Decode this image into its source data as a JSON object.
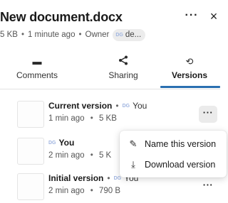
{
  "header": {
    "title": "New document.docx",
    "more_label": "···",
    "close_label": "×",
    "meta": {
      "size": "5 KB",
      "modified": "1 minute ago",
      "owner_label": "Owner",
      "owner_avatar": "DG",
      "owner_name": "de..."
    }
  },
  "tabs": [
    {
      "label": "Comments",
      "icon": "comment-icon",
      "glyph": "▬"
    },
    {
      "label": "Sharing",
      "icon": "share-icon",
      "glyph": "<"
    },
    {
      "label": "Versions",
      "icon": "history-icon",
      "glyph": "⟲",
      "active": true
    }
  ],
  "versions": [
    {
      "title": "Current version",
      "avatar": "DG",
      "user": "You",
      "time": "1 min ago",
      "size": "5 KB",
      "more": "···"
    },
    {
      "title": "",
      "avatar": "DG",
      "user": "You",
      "time": "2 min ago",
      "size": "5 K",
      "more": "···"
    },
    {
      "title": "Initial version",
      "avatar": "DG",
      "user": "You",
      "time": "2 min ago",
      "size": "790 B",
      "more": "···"
    }
  ],
  "menu": {
    "items": [
      {
        "label": "Name this version",
        "icon": "pencil-icon",
        "glyph": "✎"
      },
      {
        "label": "Download version",
        "icon": "download-icon",
        "glyph": "⤓"
      }
    ]
  },
  "separator": "•",
  "colors": {
    "accent": "#2a6fb0",
    "avatar_text": "#9fb4e0",
    "chip_bg": "#ececec",
    "active_button_bg": "#ebebeb"
  }
}
